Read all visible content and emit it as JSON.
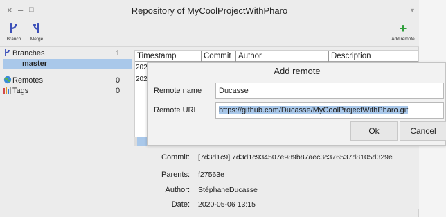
{
  "window": {
    "title": "Repository of MyCoolProjectWithPharo",
    "close_glyph": "×",
    "minimize_glyph": "–",
    "maximize_glyph": "□",
    "menu_glyph": "▼"
  },
  "toolbar": {
    "branch_label": "Branch",
    "merge_label": "Merge",
    "add_remote_label": "Add remote",
    "add_remote_glyph": "+"
  },
  "sidebar": {
    "items": [
      {
        "label": "Branches",
        "count": "1",
        "icon": "branches-icon"
      },
      {
        "label": "master",
        "count": "",
        "icon": ""
      },
      {
        "label": "Remotes",
        "count": "0",
        "icon": "remotes-icon"
      },
      {
        "label": "Tags",
        "count": "0",
        "icon": "tags-icon"
      }
    ]
  },
  "table": {
    "columns": [
      "Timestamp",
      "Commit",
      "Author",
      "Description"
    ],
    "rows": [
      {
        "timestamp": "202"
      },
      {
        "timestamp": "202"
      }
    ]
  },
  "details": {
    "commit_label": "Commit:",
    "commit_value": "[7d3d1c9] 7d3d1c934507e989b87aec3c376537d8105d329e",
    "parents_label": "Parents:",
    "parents_value": "f27563e",
    "author_label": "Author:",
    "author_value": "StéphaneDucasse",
    "date_label": "Date:",
    "date_value": "2020-05-06 13:15"
  },
  "dialog": {
    "title": "Add remote",
    "remote_name_label": "Remote name",
    "remote_name_value": "Ducasse",
    "remote_url_label": "Remote URL",
    "remote_url_value": "https://github.com/Ducasse/MyCoolProjectWithPharo.git",
    "ok_label": "Ok",
    "cancel_label": "Cancel"
  },
  "colors": {
    "selection": "#a9c8ea",
    "add_remote_green": "#2e9e3a",
    "branch_icon_blue": "#3b4fb8"
  }
}
